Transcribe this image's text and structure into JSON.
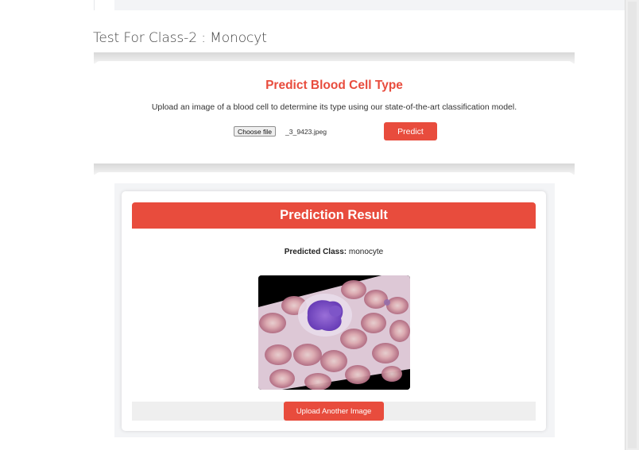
{
  "section": {
    "heading": "Test For Class-2 : Monocyt"
  },
  "predict_form": {
    "title": "Predict Blood Cell Type",
    "description": "Upload an image of a blood cell to determine its type using our state-of-the-art classification model.",
    "choose_file_label": "Choose file",
    "file_name": "_3_9423.jpeg",
    "predict_label": "Predict"
  },
  "result": {
    "header": "Prediction Result",
    "predicted_class_label": "Predicted Class:",
    "predicted_class_value": "monocyte",
    "image_alt": "blood cell image",
    "upload_another_label": "Upload Another Image"
  },
  "colors": {
    "accent": "#e84c3d",
    "page_bg": "#ffffff",
    "panel_bg": "#f3f4f6"
  }
}
